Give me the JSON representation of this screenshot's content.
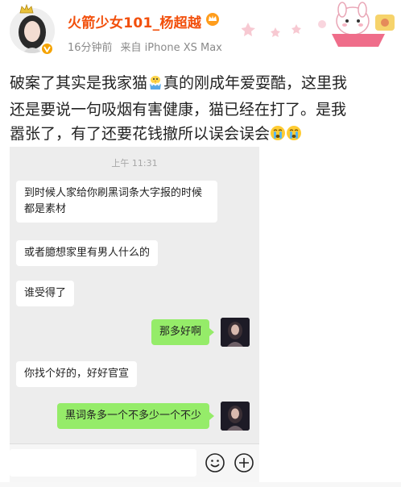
{
  "post": {
    "username": "火箭少女101_杨超越",
    "time": "16分钟前",
    "source": "来自 iPhone XS Max",
    "text_line1": "破案了其实是我家猫",
    "text_line1_after_emoji": "真的刚成年爱耍酷，这里我",
    "text_line2": "还是要说一句吸烟有害健康，猫已经在打了。是我",
    "text_line3": "嚣张了，有了还要花钱撤所以误会误会",
    "emoji_after_cat": "chick-emoji",
    "emoji_end": "crying-face-emoji"
  },
  "chat": {
    "time": "上午 11:31",
    "messages": [
      {
        "side": "left",
        "text": "到时候人家给你刷黑词条大字报的时候都是素材"
      },
      {
        "side": "left",
        "text": "或者臆想家里有男人什么的"
      },
      {
        "side": "left",
        "text": "谁受得了"
      },
      {
        "side": "right",
        "text": "那多好啊"
      },
      {
        "side": "left",
        "text": "你找个好的，好好官宣"
      },
      {
        "side": "right",
        "text": "黑词条多一个不多少一个不少"
      }
    ],
    "input_icons": [
      "smiley-icon",
      "plus-icon"
    ]
  },
  "colors": {
    "username": "#f24f0b",
    "meta": "#8a8a8a",
    "chat_bg": "#ededed",
    "bubble_self": "#95ec69",
    "bubble_other": "#ffffff"
  }
}
